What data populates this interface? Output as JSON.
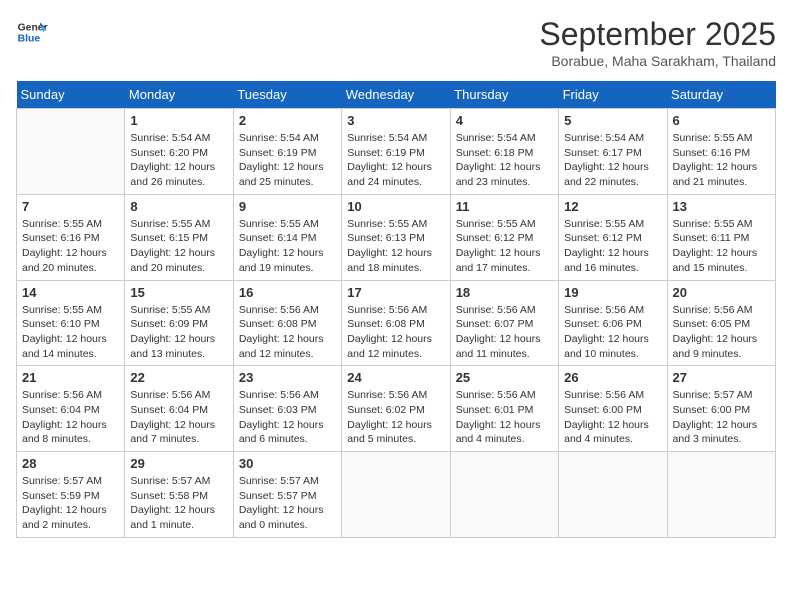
{
  "logo": {
    "line1": "General",
    "line2": "Blue"
  },
  "title": "September 2025",
  "subtitle": "Borabue, Maha Sarakham, Thailand",
  "weekdays": [
    "Sunday",
    "Monday",
    "Tuesday",
    "Wednesday",
    "Thursday",
    "Friday",
    "Saturday"
  ],
  "weeks": [
    [
      {
        "day": "",
        "text": ""
      },
      {
        "day": "1",
        "text": "Sunrise: 5:54 AM\nSunset: 6:20 PM\nDaylight: 12 hours\nand 26 minutes."
      },
      {
        "day": "2",
        "text": "Sunrise: 5:54 AM\nSunset: 6:19 PM\nDaylight: 12 hours\nand 25 minutes."
      },
      {
        "day": "3",
        "text": "Sunrise: 5:54 AM\nSunset: 6:19 PM\nDaylight: 12 hours\nand 24 minutes."
      },
      {
        "day": "4",
        "text": "Sunrise: 5:54 AM\nSunset: 6:18 PM\nDaylight: 12 hours\nand 23 minutes."
      },
      {
        "day": "5",
        "text": "Sunrise: 5:54 AM\nSunset: 6:17 PM\nDaylight: 12 hours\nand 22 minutes."
      },
      {
        "day": "6",
        "text": "Sunrise: 5:55 AM\nSunset: 6:16 PM\nDaylight: 12 hours\nand 21 minutes."
      }
    ],
    [
      {
        "day": "7",
        "text": "Sunrise: 5:55 AM\nSunset: 6:16 PM\nDaylight: 12 hours\nand 20 minutes."
      },
      {
        "day": "8",
        "text": "Sunrise: 5:55 AM\nSunset: 6:15 PM\nDaylight: 12 hours\nand 20 minutes."
      },
      {
        "day": "9",
        "text": "Sunrise: 5:55 AM\nSunset: 6:14 PM\nDaylight: 12 hours\nand 19 minutes."
      },
      {
        "day": "10",
        "text": "Sunrise: 5:55 AM\nSunset: 6:13 PM\nDaylight: 12 hours\nand 18 minutes."
      },
      {
        "day": "11",
        "text": "Sunrise: 5:55 AM\nSunset: 6:12 PM\nDaylight: 12 hours\nand 17 minutes."
      },
      {
        "day": "12",
        "text": "Sunrise: 5:55 AM\nSunset: 6:12 PM\nDaylight: 12 hours\nand 16 minutes."
      },
      {
        "day": "13",
        "text": "Sunrise: 5:55 AM\nSunset: 6:11 PM\nDaylight: 12 hours\nand 15 minutes."
      }
    ],
    [
      {
        "day": "14",
        "text": "Sunrise: 5:55 AM\nSunset: 6:10 PM\nDaylight: 12 hours\nand 14 minutes."
      },
      {
        "day": "15",
        "text": "Sunrise: 5:55 AM\nSunset: 6:09 PM\nDaylight: 12 hours\nand 13 minutes."
      },
      {
        "day": "16",
        "text": "Sunrise: 5:56 AM\nSunset: 6:08 PM\nDaylight: 12 hours\nand 12 minutes."
      },
      {
        "day": "17",
        "text": "Sunrise: 5:56 AM\nSunset: 6:08 PM\nDaylight: 12 hours\nand 12 minutes."
      },
      {
        "day": "18",
        "text": "Sunrise: 5:56 AM\nSunset: 6:07 PM\nDaylight: 12 hours\nand 11 minutes."
      },
      {
        "day": "19",
        "text": "Sunrise: 5:56 AM\nSunset: 6:06 PM\nDaylight: 12 hours\nand 10 minutes."
      },
      {
        "day": "20",
        "text": "Sunrise: 5:56 AM\nSunset: 6:05 PM\nDaylight: 12 hours\nand 9 minutes."
      }
    ],
    [
      {
        "day": "21",
        "text": "Sunrise: 5:56 AM\nSunset: 6:04 PM\nDaylight: 12 hours\nand 8 minutes."
      },
      {
        "day": "22",
        "text": "Sunrise: 5:56 AM\nSunset: 6:04 PM\nDaylight: 12 hours\nand 7 minutes."
      },
      {
        "day": "23",
        "text": "Sunrise: 5:56 AM\nSunset: 6:03 PM\nDaylight: 12 hours\nand 6 minutes."
      },
      {
        "day": "24",
        "text": "Sunrise: 5:56 AM\nSunset: 6:02 PM\nDaylight: 12 hours\nand 5 minutes."
      },
      {
        "day": "25",
        "text": "Sunrise: 5:56 AM\nSunset: 6:01 PM\nDaylight: 12 hours\nand 4 minutes."
      },
      {
        "day": "26",
        "text": "Sunrise: 5:56 AM\nSunset: 6:00 PM\nDaylight: 12 hours\nand 4 minutes."
      },
      {
        "day": "27",
        "text": "Sunrise: 5:57 AM\nSunset: 6:00 PM\nDaylight: 12 hours\nand 3 minutes."
      }
    ],
    [
      {
        "day": "28",
        "text": "Sunrise: 5:57 AM\nSunset: 5:59 PM\nDaylight: 12 hours\nand 2 minutes."
      },
      {
        "day": "29",
        "text": "Sunrise: 5:57 AM\nSunset: 5:58 PM\nDaylight: 12 hours\nand 1 minute."
      },
      {
        "day": "30",
        "text": "Sunrise: 5:57 AM\nSunset: 5:57 PM\nDaylight: 12 hours\nand 0 minutes."
      },
      {
        "day": "",
        "text": ""
      },
      {
        "day": "",
        "text": ""
      },
      {
        "day": "",
        "text": ""
      },
      {
        "day": "",
        "text": ""
      }
    ]
  ]
}
